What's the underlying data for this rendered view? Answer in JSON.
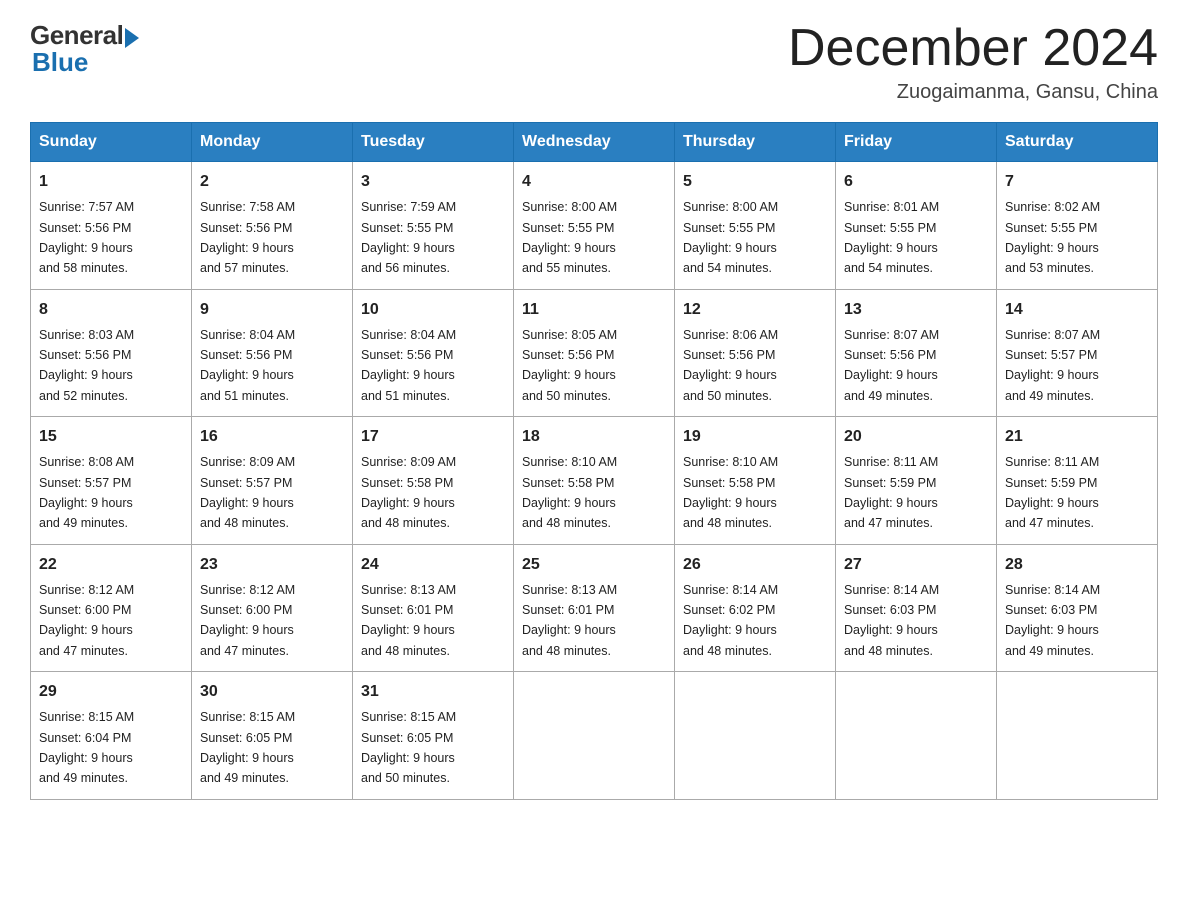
{
  "header": {
    "logo_general": "General",
    "logo_blue": "Blue",
    "month_title": "December 2024",
    "location": "Zuogaimanma, Gansu, China"
  },
  "days_of_week": [
    "Sunday",
    "Monday",
    "Tuesday",
    "Wednesday",
    "Thursday",
    "Friday",
    "Saturday"
  ],
  "weeks": [
    [
      {
        "day": "1",
        "sunrise": "7:57 AM",
        "sunset": "5:56 PM",
        "daylight": "9 hours and 58 minutes."
      },
      {
        "day": "2",
        "sunrise": "7:58 AM",
        "sunset": "5:56 PM",
        "daylight": "9 hours and 57 minutes."
      },
      {
        "day": "3",
        "sunrise": "7:59 AM",
        "sunset": "5:55 PM",
        "daylight": "9 hours and 56 minutes."
      },
      {
        "day": "4",
        "sunrise": "8:00 AM",
        "sunset": "5:55 PM",
        "daylight": "9 hours and 55 minutes."
      },
      {
        "day": "5",
        "sunrise": "8:00 AM",
        "sunset": "5:55 PM",
        "daylight": "9 hours and 54 minutes."
      },
      {
        "day": "6",
        "sunrise": "8:01 AM",
        "sunset": "5:55 PM",
        "daylight": "9 hours and 54 minutes."
      },
      {
        "day": "7",
        "sunrise": "8:02 AM",
        "sunset": "5:55 PM",
        "daylight": "9 hours and 53 minutes."
      }
    ],
    [
      {
        "day": "8",
        "sunrise": "8:03 AM",
        "sunset": "5:56 PM",
        "daylight": "9 hours and 52 minutes."
      },
      {
        "day": "9",
        "sunrise": "8:04 AM",
        "sunset": "5:56 PM",
        "daylight": "9 hours and 51 minutes."
      },
      {
        "day": "10",
        "sunrise": "8:04 AM",
        "sunset": "5:56 PM",
        "daylight": "9 hours and 51 minutes."
      },
      {
        "day": "11",
        "sunrise": "8:05 AM",
        "sunset": "5:56 PM",
        "daylight": "9 hours and 50 minutes."
      },
      {
        "day": "12",
        "sunrise": "8:06 AM",
        "sunset": "5:56 PM",
        "daylight": "9 hours and 50 minutes."
      },
      {
        "day": "13",
        "sunrise": "8:07 AM",
        "sunset": "5:56 PM",
        "daylight": "9 hours and 49 minutes."
      },
      {
        "day": "14",
        "sunrise": "8:07 AM",
        "sunset": "5:57 PM",
        "daylight": "9 hours and 49 minutes."
      }
    ],
    [
      {
        "day": "15",
        "sunrise": "8:08 AM",
        "sunset": "5:57 PM",
        "daylight": "9 hours and 49 minutes."
      },
      {
        "day": "16",
        "sunrise": "8:09 AM",
        "sunset": "5:57 PM",
        "daylight": "9 hours and 48 minutes."
      },
      {
        "day": "17",
        "sunrise": "8:09 AM",
        "sunset": "5:58 PM",
        "daylight": "9 hours and 48 minutes."
      },
      {
        "day": "18",
        "sunrise": "8:10 AM",
        "sunset": "5:58 PM",
        "daylight": "9 hours and 48 minutes."
      },
      {
        "day": "19",
        "sunrise": "8:10 AM",
        "sunset": "5:58 PM",
        "daylight": "9 hours and 48 minutes."
      },
      {
        "day": "20",
        "sunrise": "8:11 AM",
        "sunset": "5:59 PM",
        "daylight": "9 hours and 47 minutes."
      },
      {
        "day": "21",
        "sunrise": "8:11 AM",
        "sunset": "5:59 PM",
        "daylight": "9 hours and 47 minutes."
      }
    ],
    [
      {
        "day": "22",
        "sunrise": "8:12 AM",
        "sunset": "6:00 PM",
        "daylight": "9 hours and 47 minutes."
      },
      {
        "day": "23",
        "sunrise": "8:12 AM",
        "sunset": "6:00 PM",
        "daylight": "9 hours and 47 minutes."
      },
      {
        "day": "24",
        "sunrise": "8:13 AM",
        "sunset": "6:01 PM",
        "daylight": "9 hours and 48 minutes."
      },
      {
        "day": "25",
        "sunrise": "8:13 AM",
        "sunset": "6:01 PM",
        "daylight": "9 hours and 48 minutes."
      },
      {
        "day": "26",
        "sunrise": "8:14 AM",
        "sunset": "6:02 PM",
        "daylight": "9 hours and 48 minutes."
      },
      {
        "day": "27",
        "sunrise": "8:14 AM",
        "sunset": "6:03 PM",
        "daylight": "9 hours and 48 minutes."
      },
      {
        "day": "28",
        "sunrise": "8:14 AM",
        "sunset": "6:03 PM",
        "daylight": "9 hours and 49 minutes."
      }
    ],
    [
      {
        "day": "29",
        "sunrise": "8:15 AM",
        "sunset": "6:04 PM",
        "daylight": "9 hours and 49 minutes."
      },
      {
        "day": "30",
        "sunrise": "8:15 AM",
        "sunset": "6:05 PM",
        "daylight": "9 hours and 49 minutes."
      },
      {
        "day": "31",
        "sunrise": "8:15 AM",
        "sunset": "6:05 PM",
        "daylight": "9 hours and 50 minutes."
      },
      null,
      null,
      null,
      null
    ]
  ],
  "labels": {
    "sunrise": "Sunrise:",
    "sunset": "Sunset:",
    "daylight": "Daylight: 9 hours"
  }
}
